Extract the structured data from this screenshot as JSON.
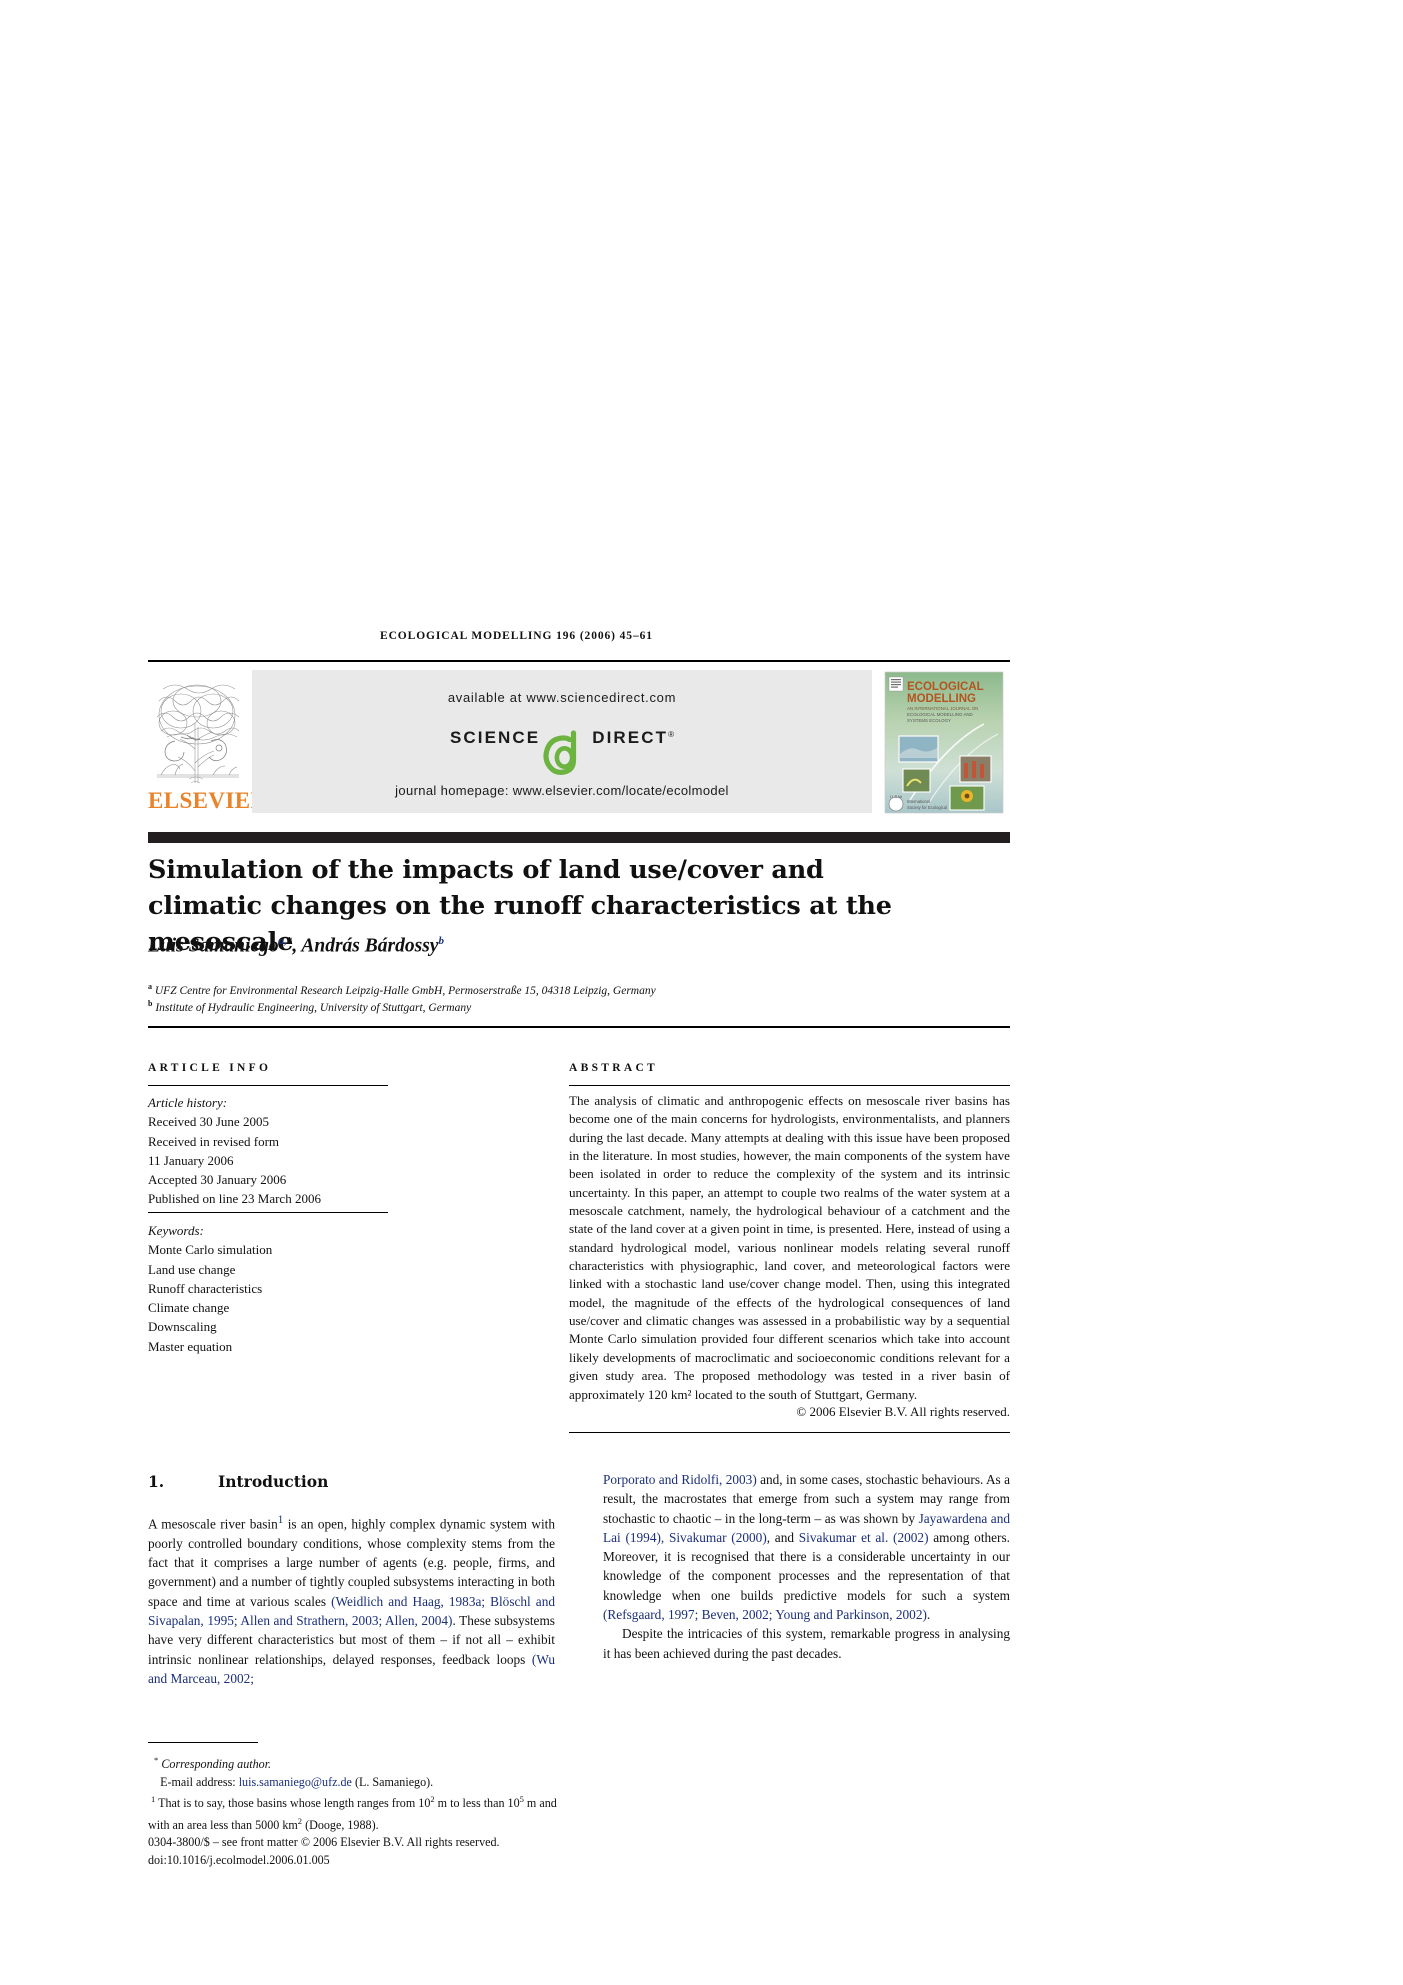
{
  "running_head": "ECOLOGICAL MODELLING 196 (2006) 45–61",
  "banner": {
    "publisher_name": "ELSEVIER",
    "available_at": "available at www.sciencedirect.com",
    "logo_science": "SCIENCE",
    "logo_direct": "DIRECT",
    "logo_reg": "®",
    "journal_homepage": "journal homepage: www.elsevier.com/locate/ecolmodel",
    "cover_title_line1": "ECOLOGICAL",
    "cover_title_line2": "MODELLING",
    "cover_subtitle": "AN INTERNATIONAL JOURNAL ON ECOLOGICAL MODELLING AND SYSTEMS ECOLOGY"
  },
  "article": {
    "title": "Simulation of the impacts of land use/cover and climatic changes on the runoff characteristics at the mesoscale",
    "authors_plain": "Luis Samaniego, András Bárdossy",
    "author1_name": "Luis Samaniego",
    "author1_sup": "a,",
    "author1_star": "*",
    "author2_name": "András Bárdossy",
    "author2_sup": "b",
    "affiliation_a_sup": "a",
    "affiliation_a": "UFZ Centre for Environmental Research Leipzig-Halle GmbH, Permoserstraße 15, 04318 Leipzig, Germany",
    "affiliation_b_sup": "b",
    "affiliation_b": "Institute of Hydraulic Engineering, University of Stuttgart, Germany"
  },
  "info": {
    "heading": "ARTICLE INFO",
    "history_label": "Article history:",
    "history": [
      "Received 30 June 2005",
      "Received in revised form",
      "11 January 2006",
      "Accepted 30 January 2006",
      "Published on line 23 March 2006"
    ],
    "keywords_label": "Keywords:",
    "keywords": [
      "Monte Carlo simulation",
      "Land use change",
      "Runoff characteristics",
      "Climate change",
      "Downscaling",
      "Master equation"
    ]
  },
  "abstract": {
    "heading": "ABSTRACT",
    "text": "The analysis of climatic and anthropogenic effects on mesoscale river basins has become one of the main concerns for hydrologists, environmentalists, and planners during the last decade. Many attempts at dealing with this issue have been proposed in the literature. In most studies, however, the main components of the system have been isolated in order to reduce the complexity of the system and its intrinsic uncertainty. In this paper, an attempt to couple two realms of the water system at a mesoscale catchment, namely, the hydrological behaviour of a catchment and the state of the land cover at a given point in time, is presented. Here, instead of using a standard hydrological model, various nonlinear models relating several runoff characteristics with physiographic, land cover, and meteorological factors were linked with a stochastic land use/cover change model. Then, using this integrated model, the magnitude of the effects of the hydrological consequences of land use/cover and climatic changes was assessed in a probabilistic way by a sequential Monte Carlo simulation provided four different scenarios which take into account likely developments of macroclimatic and socioeconomic conditions relevant for a given study area. The proposed methodology was tested in a river basin of approximately 120 km² located to the south of Stuttgart, Germany.",
    "copyright": "© 2006 Elsevier B.V. All rights reserved."
  },
  "body": {
    "section_number": "1.",
    "section_title": "Introduction",
    "left_col_parts": {
      "p1_a": "A mesoscale river basin",
      "p1_sup": "1",
      "p1_b": " is an open, highly complex dynamic system with poorly controlled boundary conditions, whose complexity stems from the fact that it comprises a large number of agents (e.g. people, firms, and government) and a number of tightly coupled subsystems interacting in both space and time at various scales ",
      "p1_cite1": "(Weidlich and Haag, 1983a; Blöschl and Sivapalan, 1995; Allen and Strathern, 2003; Allen, 2004)",
      "p1_c": ". These subsystems have very different characteristics but most of them – if not all – exhibit intrinsic nonlinear relationships, delayed responses, feedback loops ",
      "p1_cite2": "(Wu and Marceau, 2002;"
    },
    "right_col_parts": {
      "p1_cite_cont": "Porporato and Ridolfi, 2003)",
      "p1_a": " and, in some cases, stochastic behaviours. As a result, the macrostates that emerge from such a system may range from stochastic to chaotic – in the long-term – as was shown by ",
      "p1_cite1": "Jayawardena and Lai (1994), Sivakumar (2000)",
      "p1_b": ", and ",
      "p1_cite2": "Sivakumar et al. (2002)",
      "p1_c": " among others. Moreover, it is recognised that there is a considerable uncertainty in our knowledge of the component processes and the representation of that knowledge when one builds predictive models for such a system ",
      "p1_cite3": "(Refsgaard, 1997; Beven, 2002; Young and Parkinson, 2002)",
      "p1_d": ".",
      "p2": "Despite the intricacies of this system, remarkable progress in analysing it has been achieved during the past decades."
    }
  },
  "footnotes": {
    "corresponding_star": "*",
    "corresponding": "Corresponding author.",
    "email_label": "E-mail address:",
    "email": "luis.samaniego@ufz.de",
    "email_person": "(L. Samaniego).",
    "note1_sup": "1",
    "note1_a": "That is to say, those basins whose length ranges from 10",
    "note1_sup1": "2",
    "note1_b": " m to less than 10",
    "note1_sup2": "5",
    "note1_c": " m and with an area less than 5000 km",
    "note1_sup3": "2",
    "note1_d": " (Dooge, 1988).",
    "issn_line": "0304-3800/$ – see front matter © 2006 Elsevier B.V. All rights reserved.",
    "doi_line": "doi:10.1016/j.ecolmodel.2006.01.005"
  },
  "colors": {
    "citation_blue": "#1b2f7a",
    "elsevier_orange": "#e8832a",
    "sciencedirect_green": "#6cb33f",
    "banner_gray": "#e9e9e9",
    "black_bar": "#231f20"
  }
}
